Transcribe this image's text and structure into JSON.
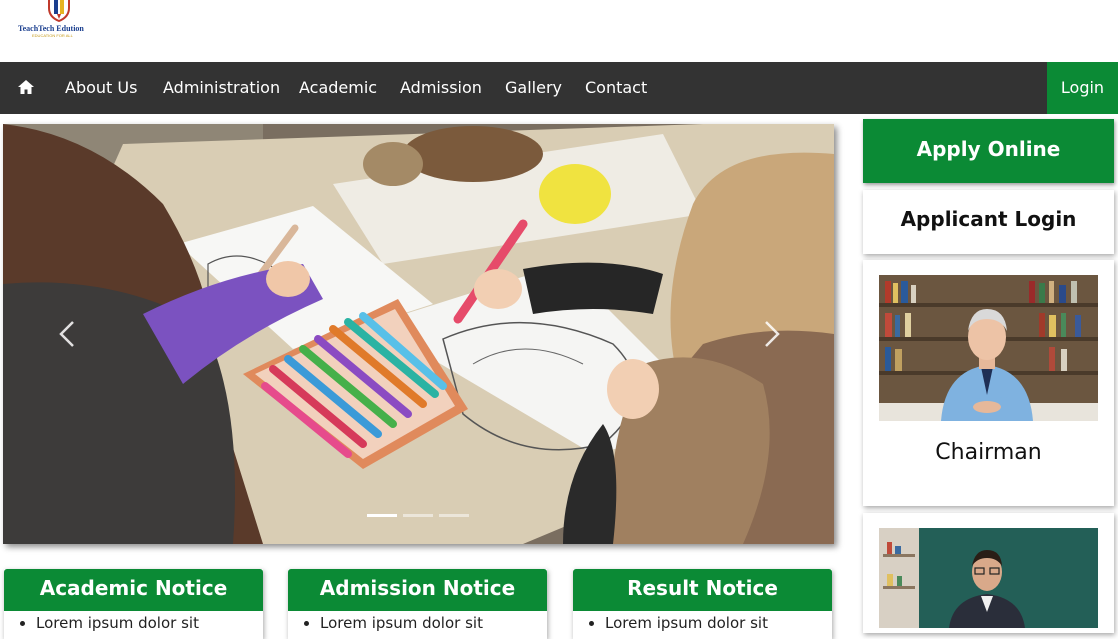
{
  "logo": {
    "name": "TeachTech Edution",
    "tagline": "EDUCATION FOR ALL"
  },
  "nav": {
    "home_icon": "home-icon",
    "items": [
      "About Us",
      "Administration",
      "Academic",
      "Admission",
      "Gallery",
      "Contact"
    ],
    "login": "Login"
  },
  "carousel": {
    "prev_icon": "chevron-left-icon",
    "next_icon": "chevron-right-icon",
    "slide_count": 3,
    "active_slide": 1
  },
  "sidebar": {
    "apply_label": "Apply Online",
    "applicant_login_label": "Applicant Login",
    "chairman_caption": "Chairman"
  },
  "notices": [
    {
      "title": "Academic Notice",
      "first_item": "Lorem ipsum dolor sit"
    },
    {
      "title": "Admission Notice",
      "first_item": "Lorem ipsum dolor sit"
    },
    {
      "title": "Result Notice",
      "first_item": "Lorem ipsum dolor sit"
    }
  ],
  "colors": {
    "brand_green": "#0b8a35",
    "navbar": "#333333",
    "logo_blue": "#1b3f8f"
  }
}
